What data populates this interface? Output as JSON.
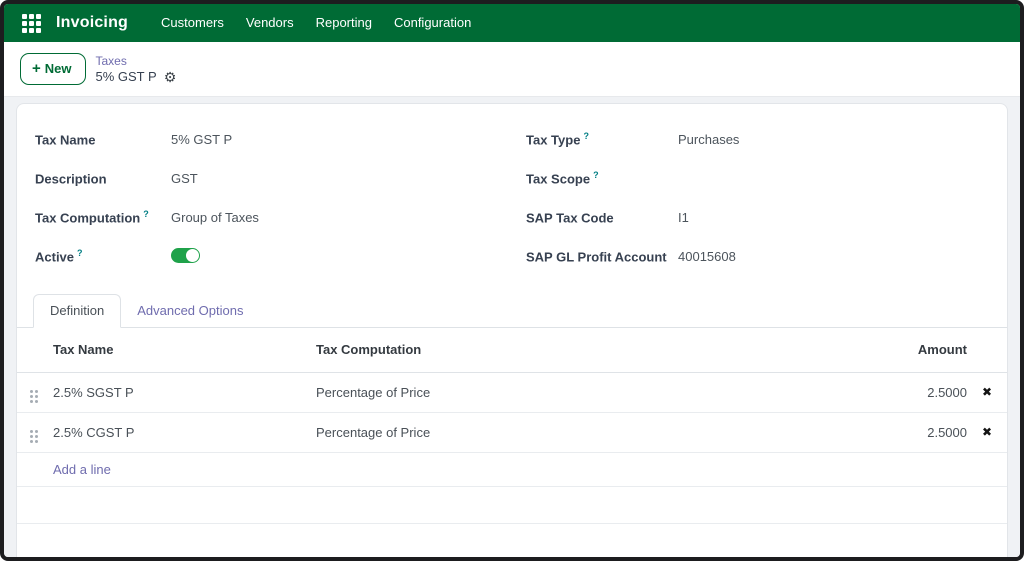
{
  "colors": {
    "navbar_green": "#006B35",
    "toggle_green": "#1FA24A",
    "link_purple": "#6F6CAE",
    "help_teal": "#017E84"
  },
  "navbar": {
    "brand": "Invoicing",
    "items": [
      {
        "label": "Customers"
      },
      {
        "label": "Vendors"
      },
      {
        "label": "Reporting"
      },
      {
        "label": "Configuration"
      }
    ]
  },
  "icons": {
    "apps": "apps-grid-icon",
    "plus_glyph": "+",
    "gear_glyph": "⚙",
    "delete_glyph": "✖"
  },
  "control_panel": {
    "new_button_label": "New",
    "breadcrumb_parent": "Taxes",
    "breadcrumb_current": "5% GST P"
  },
  "form": {
    "left": [
      {
        "label": "Tax Name",
        "help": "",
        "value": "5% GST P"
      },
      {
        "label": "Description",
        "help": "",
        "value": "GST"
      },
      {
        "label": "Tax Computation",
        "help": "?",
        "value": "Group of Taxes"
      },
      {
        "label": "Active",
        "help": "?",
        "value": ""
      }
    ],
    "right": [
      {
        "label": "Tax Type",
        "help": "?",
        "value": "Purchases"
      },
      {
        "label": "Tax Scope",
        "help": "?",
        "value": ""
      },
      {
        "label": "SAP Tax Code",
        "help": "",
        "value": "I1"
      },
      {
        "label": "SAP GL Profit Account",
        "help": "",
        "value": "40015608"
      }
    ],
    "active_toggle_state": "on"
  },
  "tabs": [
    {
      "label": "Definition"
    },
    {
      "label": "Advanced Options"
    }
  ],
  "table": {
    "headers": {
      "tax_name": "Tax Name",
      "tax_computation": "Tax Computation",
      "amount": "Amount"
    },
    "rows": [
      {
        "tax_name": "2.5% SGST P",
        "tax_computation": "Percentage of Price",
        "amount": "2.5000"
      },
      {
        "tax_name": "2.5% CGST P",
        "tax_computation": "Percentage of Price",
        "amount": "2.5000"
      }
    ],
    "add_line_label": "Add a line"
  }
}
